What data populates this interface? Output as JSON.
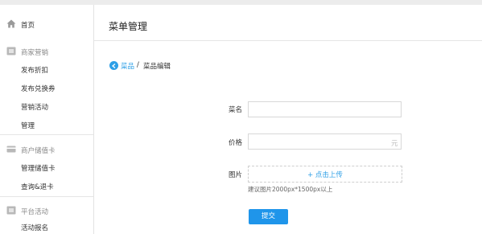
{
  "sidebar": {
    "home_label": "首页",
    "sections": [
      {
        "title": "商家营销",
        "icon": "promo-icon",
        "items": [
          "发布折扣",
          "发布兑换券",
          "营销活动",
          "管理"
        ]
      },
      {
        "title": "商户储值卡",
        "icon": "card-icon",
        "items": [
          "管理储值卡",
          "查询&退卡"
        ]
      },
      {
        "title": "平台活动",
        "icon": "activity-icon",
        "items": [
          "活动报名"
        ]
      }
    ]
  },
  "main": {
    "title": "菜单管理",
    "breadcrumb": {
      "link": "菜品",
      "separator": "/",
      "current": "菜品编辑"
    },
    "form": {
      "name_label": "菜名",
      "name_value": "",
      "price_label": "价格",
      "price_value": "",
      "price_unit": "元",
      "image_label": "图片",
      "upload_text": "+ 点击上传",
      "image_hint": "建议图片2000px*1500px以上",
      "submit_label": "提交"
    }
  },
  "colors": {
    "accent": "#1f95ea",
    "link": "#2e9fe6",
    "border": "#d8d8d8",
    "divider": "#e6e6e6"
  }
}
